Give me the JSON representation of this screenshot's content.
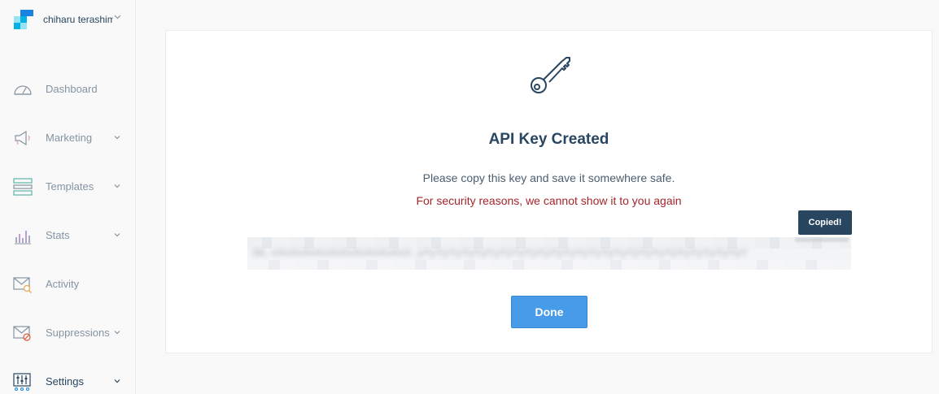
{
  "sidebar": {
    "account": {
      "name": "chiharu terashima",
      "logo_colors": [
        "#1a82e2",
        "#00b3e3",
        "#99e1f4",
        "#294661"
      ]
    },
    "items": [
      {
        "label": "Dashboard",
        "icon": "gauge-icon",
        "has_submenu": false
      },
      {
        "label": "Marketing",
        "icon": "megaphone-icon",
        "has_submenu": true
      },
      {
        "label": "Templates",
        "icon": "templates-icon",
        "has_submenu": true
      },
      {
        "label": "Stats",
        "icon": "bar-chart-icon",
        "has_submenu": true
      },
      {
        "label": "Activity",
        "icon": "envelope-search-icon",
        "has_submenu": false
      },
      {
        "label": "Suppressions",
        "icon": "envelope-blocked-icon",
        "has_submenu": true
      },
      {
        "label": "Settings",
        "icon": "sliders-icon",
        "has_submenu": true,
        "active": true
      }
    ]
  },
  "dialog": {
    "icon": "key-icon",
    "title": "API Key Created",
    "description": "Please copy this key and save it somewhere safe.",
    "warning": "For security reasons, we cannot show it to you again",
    "tooltip": "Copied!",
    "api_key_blurred": "SG.xXxXxXxXxXxXxXxXxXxXxX.yYyYyYyYyYyYyYyYyYyYyYyYyYyYyYyYyYyYyYyYyYyYyYyYyYyY",
    "done_label": "Done"
  },
  "colors": {
    "accent": "#489be8",
    "warning": "#a3262b",
    "text_primary": "#294661",
    "tooltip_bg": "#294661"
  }
}
